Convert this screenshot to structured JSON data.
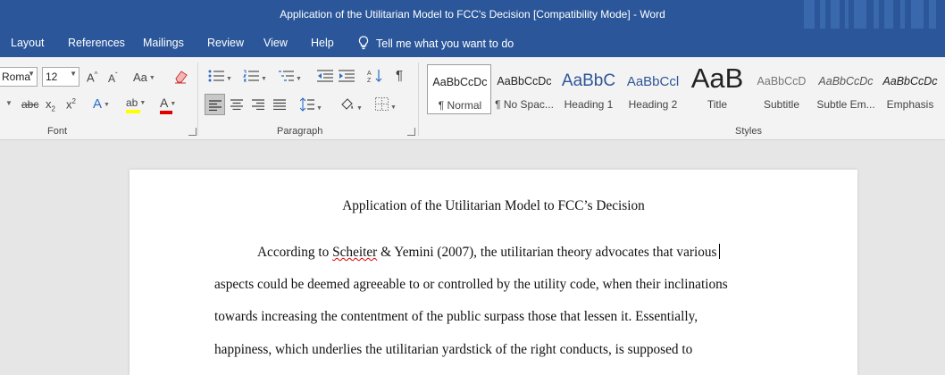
{
  "window": {
    "title": "Application of the Utilitarian Model to FCC's Decision [Compatibility Mode]  -  Word"
  },
  "tabs": [
    {
      "label": "Layout"
    },
    {
      "label": "References"
    },
    {
      "label": "Mailings"
    },
    {
      "label": "Review"
    },
    {
      "label": "View"
    },
    {
      "label": "Help"
    }
  ],
  "tell_me": {
    "label": "Tell me what you want to do"
  },
  "ribbon": {
    "font": {
      "group_label": "Font",
      "font_name": "Roma",
      "font_size": "12",
      "grow_glyph": "A",
      "shrink_glyph": "A",
      "case_glyph": "Aa",
      "strike_glyph": "abc",
      "sub_glyph": "x",
      "sub_mark": "2",
      "sup_glyph": "x",
      "sup_mark": "2",
      "effects_glyph": "A",
      "highlight_glyph": "ab",
      "color_glyph": "A",
      "colors": {
        "highlight": "#ffff00",
        "font_color": "#e00000"
      }
    },
    "paragraph": {
      "group_label": "Paragraph"
    },
    "styles": {
      "group_label": "Styles",
      "items": [
        {
          "preview": "AaBbCcDc",
          "name": "¶ Normal",
          "selected": true
        },
        {
          "preview": "AaBbCcDc",
          "name": "¶ No Spac..."
        },
        {
          "preview": "AaBbC",
          "name": "Heading 1"
        },
        {
          "preview": "AaBbCcl",
          "name": "Heading 2"
        },
        {
          "preview": "AaB",
          "name": "Title"
        },
        {
          "preview": "AaBbCcD",
          "name": "Subtitle"
        },
        {
          "preview": "AaBbCcDc",
          "name": "Subtle Em..."
        },
        {
          "preview": "AaBbCcDc",
          "name": "Emphasis"
        }
      ]
    }
  },
  "document": {
    "title": "Application of the Utilitarian Model to FCC’s Decision",
    "line1": {
      "before": "According to ",
      "misspelled": "Scheiter",
      "after": " & Yemini (2007), the utilitarian theory advocates that various"
    },
    "lines": [
      "aspects could be deemed agreeable to or controlled by the utility code, when their inclinations",
      "towards increasing the contentment of the public surpass those that lessen it. Essentially,",
      "happiness, which underlies the utilitarian yardstick of the right conducts, is supposed to"
    ]
  }
}
